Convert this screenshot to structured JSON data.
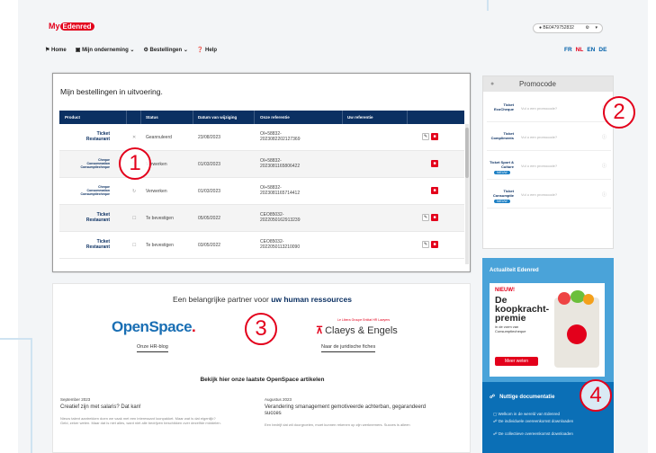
{
  "header": {
    "logo_my": "My",
    "logo_brand": "Edenred",
    "user_phone": "BE0479752832",
    "gear": "⚙",
    "chevron": "▾"
  },
  "nav": {
    "home": "Home",
    "company": "Mijn onderneming",
    "orders": "Bestellingen",
    "help": "Help"
  },
  "languages": [
    "FR",
    "NL",
    "EN",
    "DE"
  ],
  "orders": {
    "title": "Mijn bestellingen in uitvoering.",
    "columns": [
      "Product",
      "",
      "Status",
      "Datum van wijziging",
      "Onze referentie",
      "Uw referentie"
    ],
    "rows": [
      {
        "logo": "Ticket Restaurant",
        "status": "Geannuleerd",
        "date": "23/08/2023",
        "ref": "OI+58832-\n2023082202127369",
        "edit": true
      },
      {
        "logo": "Cheque Consommation Consumptiecheque",
        "status": "Verwerken",
        "date": "01/03/2023",
        "ref": "OI+58832-\n2023081165806422",
        "edit": false
      },
      {
        "logo": "Cheque Consommation Consumptiecheque",
        "status": "Verwerken",
        "date": "01/03/2023",
        "ref": "OI+58832-\n2023081165714412",
        "edit": false
      },
      {
        "logo": "Ticket Restaurant",
        "status": "Te bevestigen",
        "date": "05/05/2022",
        "ref": "CEO85032-\n2022050162913239",
        "edit": true
      },
      {
        "logo": "Ticket Restaurant",
        "status": "Te bevestigen",
        "date": "03/05/2022",
        "ref": "CEO85032-\n2022050113210090",
        "edit": true
      }
    ]
  },
  "promo": {
    "title": "Promocode",
    "placeholder": "Vul u een promocode?",
    "rows": [
      {
        "logo": "Ticket EcoCheque",
        "new": false
      },
      {
        "logo": "Ticket Compliments",
        "new": false
      },
      {
        "logo": "Ticket Sport & Culture",
        "new": true
      },
      {
        "logo": "Ticket Consumptie",
        "new": true
      }
    ],
    "new_label": "NIEUW"
  },
  "actualiteit": {
    "title": "Actualiteit Edenred",
    "new_label": "NIEUW!",
    "headline": "De koopkracht-premie",
    "subtext": "in de vorm van Consumptiecheque",
    "button": "Meer weten"
  },
  "docs": {
    "title": "Nuttige documentatie",
    "items": [
      "Welkom in de wereld van Edenred",
      "De individuele overeenkomst downloaden",
      "De collectieve overeenkomst downloaden"
    ]
  },
  "partner": {
    "title_pre": "Een belangrijke partner voor",
    "title_bold": "uw human ressources",
    "openspace": "OpenSpace",
    "openspace_link": "Onze HR-blog",
    "claeys_small": "Le Libera Groupe Entitat HR Lawyers",
    "claeys": "Claeys & Engels",
    "claeys_link": "Naar de juridische fiches",
    "articles_title": "Bekijk hier onze laatste OpenSpace artikelen",
    "articles": [
      {
        "date": "September 2023",
        "title": "Creatief zijn met salaris? Dat kan!",
        "text": "Nieuw talent aantrekken doen we vaak met een interessant loonpakket. Maar wat is dat eigenlijk? Geld, zeker weten. Maar dat is niet alles, want niet alle bedrijven beschikken over dezelfde middelen."
      },
      {
        "date": "Augustus 2023",
        "title": "Verandering smanagement gemotiveerde achterban, gegarandeerd succes",
        "text": "Een bedrijf dat wil doorgroeien, moet kunnen rekenen op zijn werknemers. Succes is alleen"
      }
    ]
  },
  "callouts": [
    "1",
    "2",
    "3",
    "4"
  ]
}
